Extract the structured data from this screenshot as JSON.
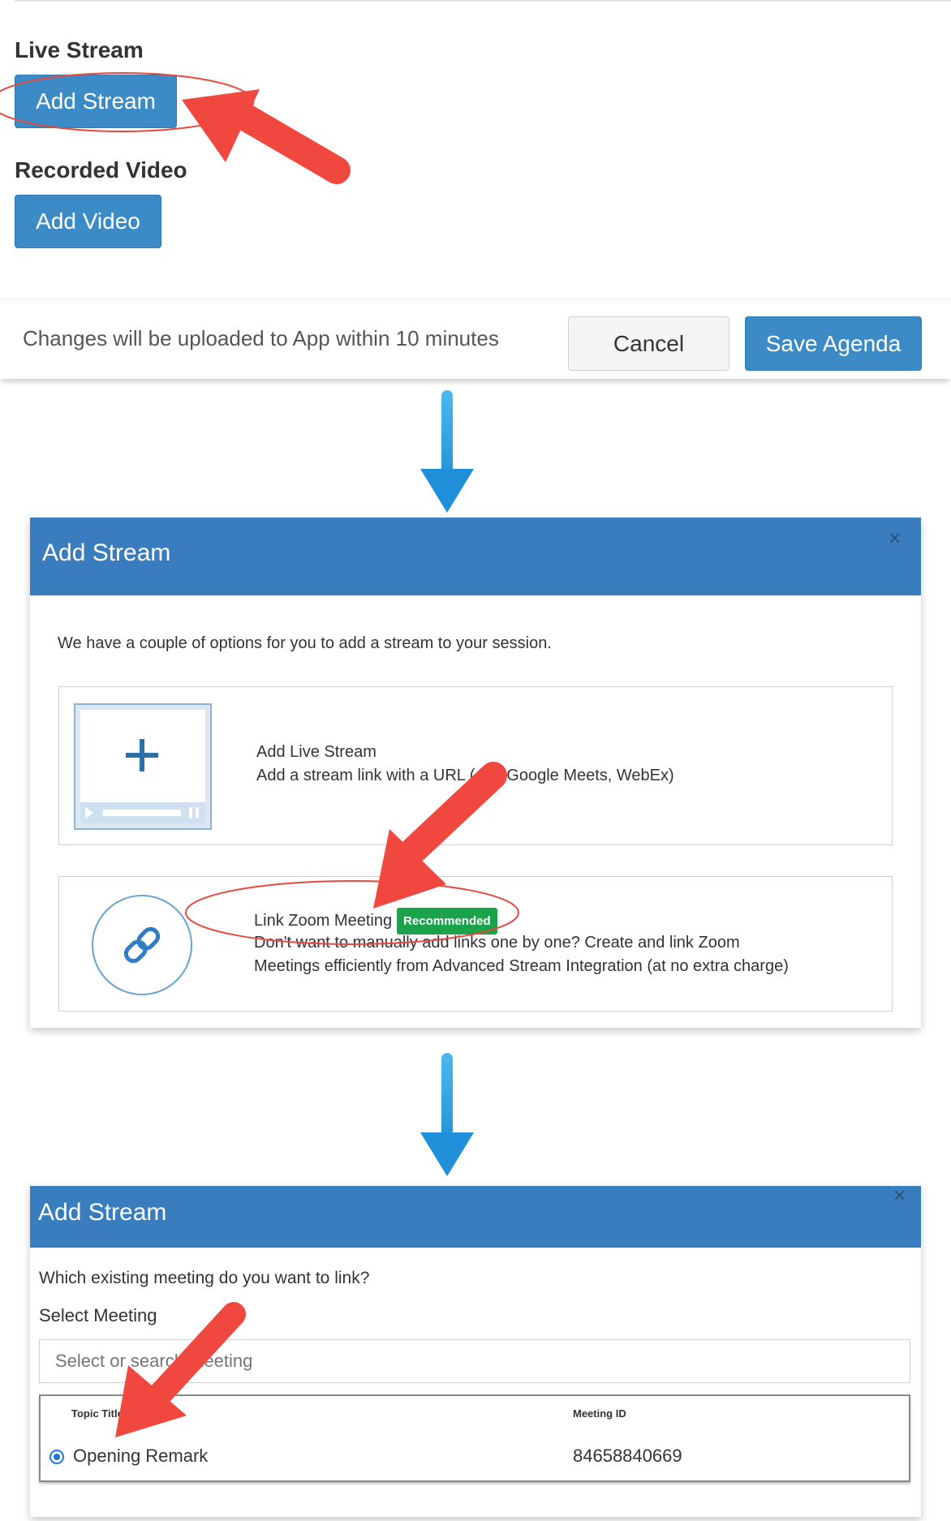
{
  "section_live": {
    "heading": "Live Stream",
    "add_stream_label": "Add Stream"
  },
  "section_recorded": {
    "heading": "Recorded Video",
    "add_video_label": "Add Video"
  },
  "footer": {
    "notice": "Changes will be uploaded to App within 10 minutes",
    "cancel_label": "Cancel",
    "save_label": "Save Agenda"
  },
  "modal1": {
    "title": "Add Stream",
    "close": "×",
    "intro": "We have a couple of options for you to add a stream to your session.",
    "option_live": {
      "title": "Add Live Stream",
      "desc": "Add a stream link with a URL (e.g. Google Meets, WebEx)"
    },
    "option_zoom": {
      "title": "Link Zoom Meeting",
      "badge": "Recommended",
      "desc_line1": "Don't want to manually add links one by one? Create and link Zoom",
      "desc_line2": "Meetings efficiently from Advanced Stream Integration (at no extra charge)"
    }
  },
  "modal2": {
    "title": "Add Stream",
    "close": "×",
    "question": "Which existing meeting do you want to link?",
    "select_label": "Select Meeting",
    "select_placeholder": "Select or search meeting",
    "table": {
      "columns": [
        "Topic Title",
        "Meeting ID"
      ],
      "rows": [
        {
          "topic": "Opening Remark",
          "meeting_id": "84658840669",
          "selected": true
        }
      ]
    }
  },
  "colors": {
    "primary_blue": "#3d8bc6",
    "modal_header": "#3a7dbf",
    "badge_green": "#1aa34a",
    "annotation_red": "#f0483e",
    "flow_arrow_blue": "#2aa3e6"
  }
}
